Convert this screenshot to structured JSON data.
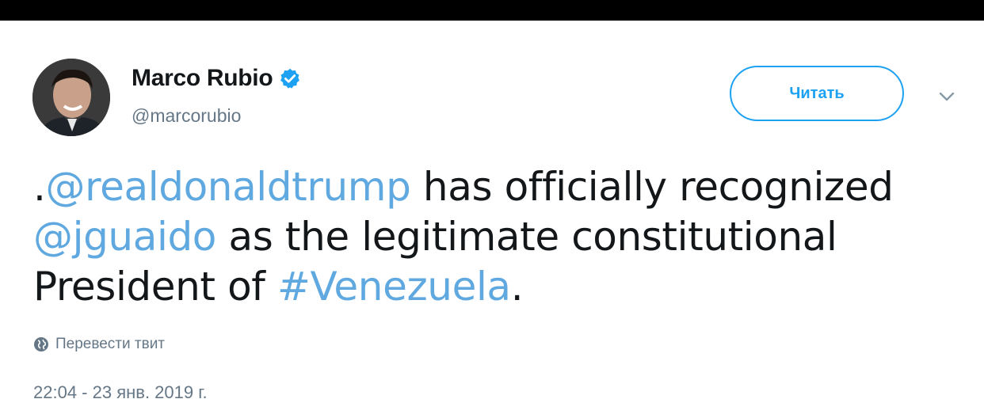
{
  "tweet": {
    "author": {
      "name": "Marco Rubio",
      "handle": "@marcorubio",
      "verified": true
    },
    "follow_label": "Читать",
    "text_segments": [
      {
        "text": ".",
        "type": "text"
      },
      {
        "text": "@realdonaldtrump",
        "type": "mention"
      },
      {
        "text": " has officially recognized ",
        "type": "text"
      },
      {
        "text": "@jguaido",
        "type": "mention"
      },
      {
        "text": " as the legitimate constitutional President of ",
        "type": "text"
      },
      {
        "text": "#Venezuela",
        "type": "hashtag"
      },
      {
        "text": ".",
        "type": "text"
      }
    ],
    "translate_label": "Перевести твит",
    "timestamp": "22:04 - 23 янв. 2019 г."
  },
  "icons": {
    "verified": "verified-badge-icon",
    "caret": "chevron-down-icon",
    "translate": "globe-icon"
  },
  "colors": {
    "link": "#5fa9e0",
    "accent": "#1da1f2",
    "muted": "#657786",
    "text": "#14171a"
  }
}
